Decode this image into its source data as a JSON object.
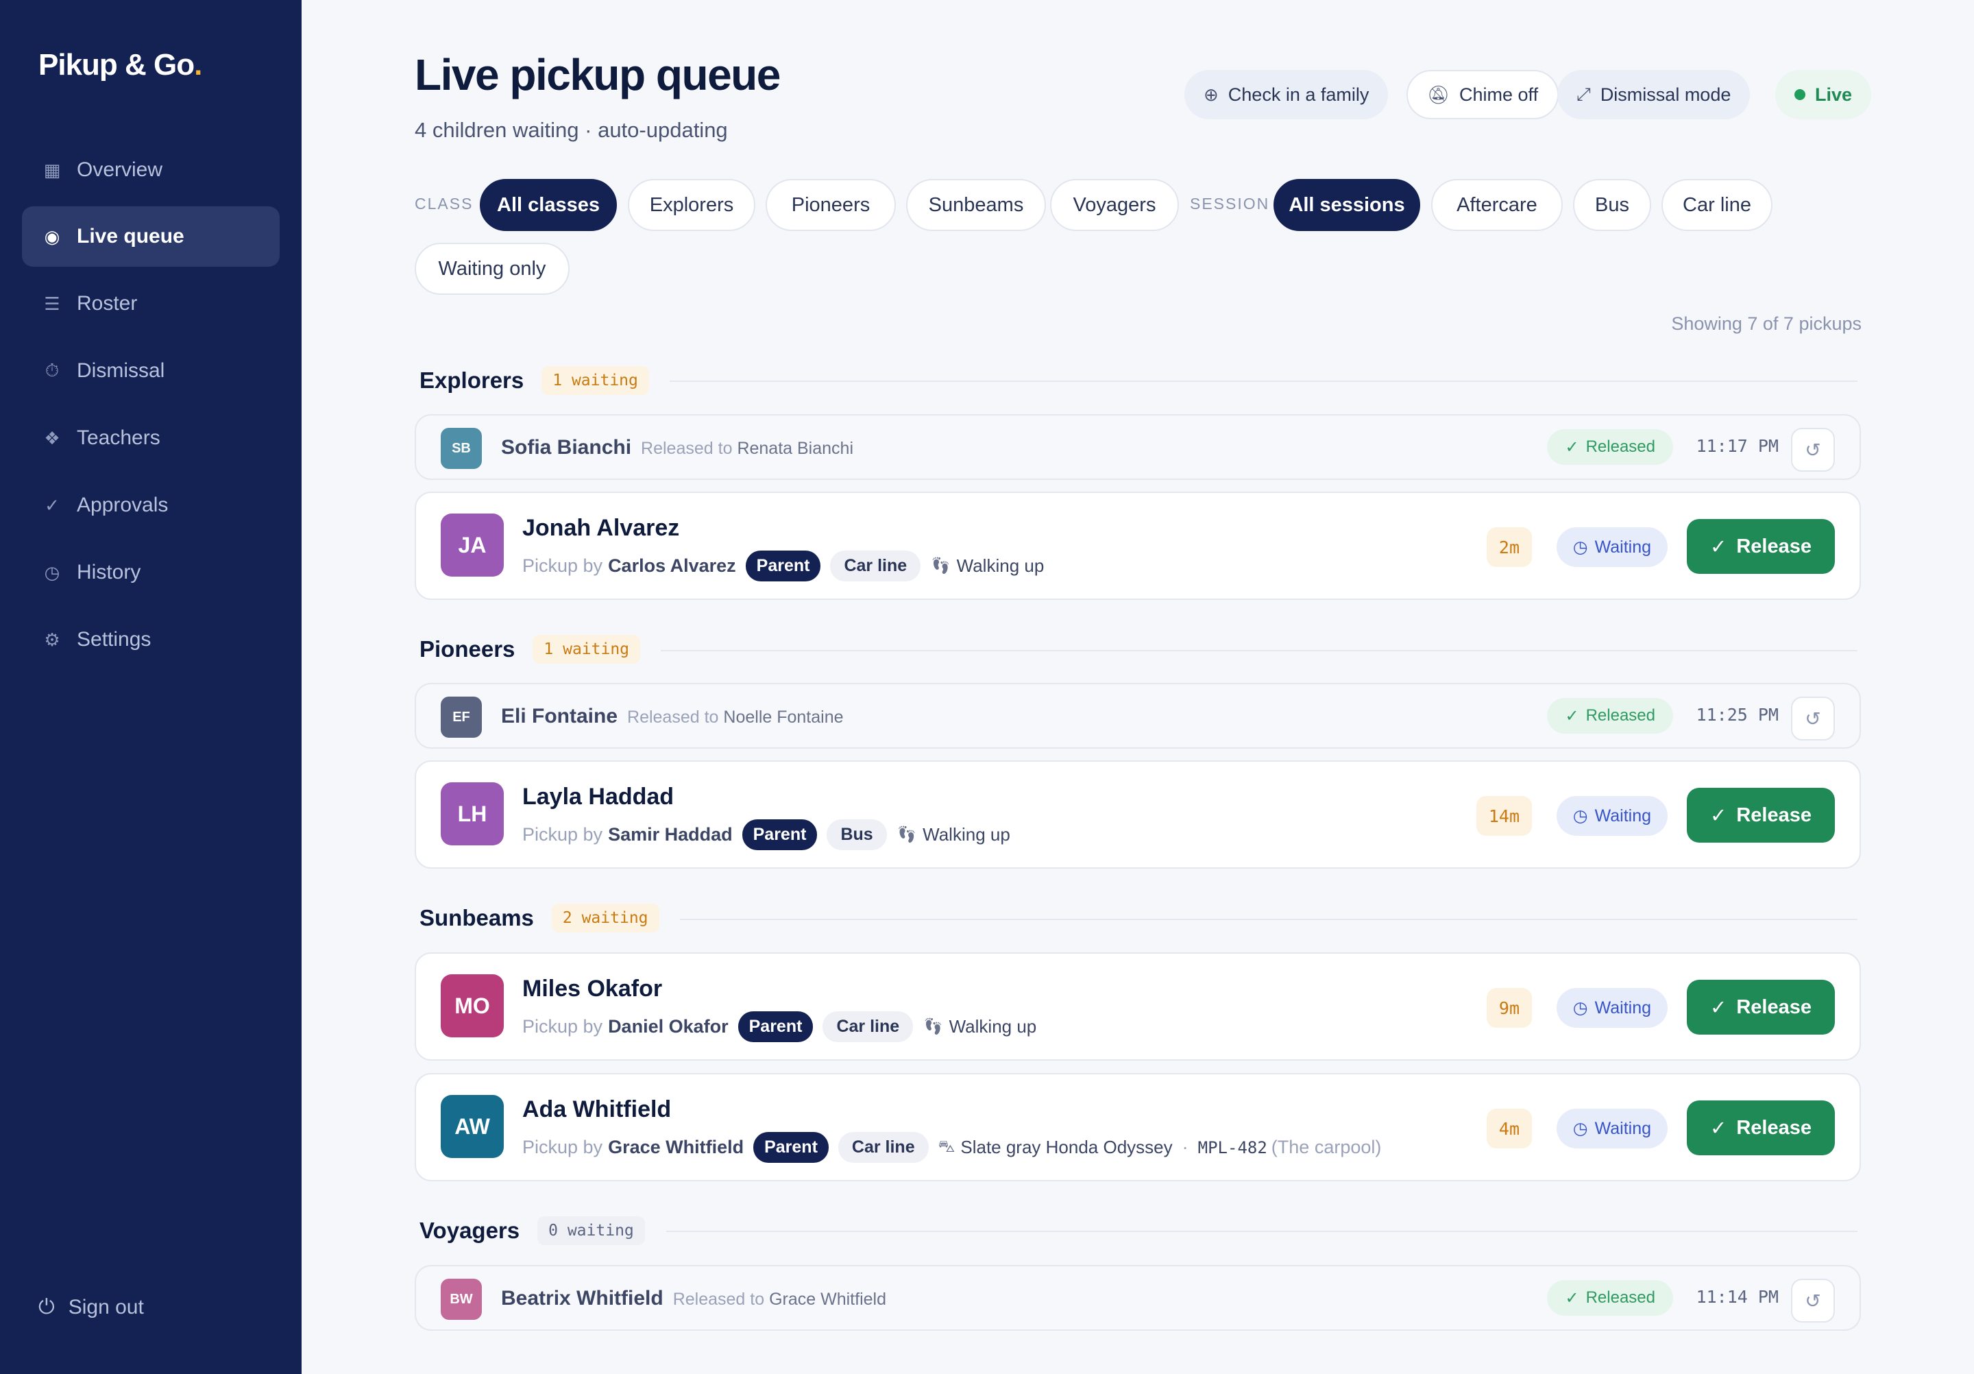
{
  "app": {
    "logo": "Pikup & Go",
    "logo_dot": "."
  },
  "nav": [
    {
      "icon": "▦",
      "label": "Overview"
    },
    {
      "icon": "◉",
      "label": "Live queue"
    },
    {
      "icon": "☰",
      "label": "Roster"
    },
    {
      "icon": "⏱",
      "label": "Dismissal"
    },
    {
      "icon": "❖",
      "label": "Teachers"
    },
    {
      "icon": "✓",
      "label": "Approvals"
    },
    {
      "icon": "◷",
      "label": "History"
    },
    {
      "icon": "⚙",
      "label": "Settings"
    }
  ],
  "sign_out": {
    "icon": "⏻",
    "label": "Sign out"
  },
  "header": {
    "title": "Live pickup queue",
    "subtitle": "4 children waiting · auto-updating",
    "check_in": "Check in a family",
    "chime": "Chime off",
    "dismissal": "Dismissal mode",
    "live": "Live"
  },
  "filters": {
    "class_label": "CLASS",
    "classes": [
      "All classes",
      "Explorers",
      "Pioneers",
      "Sunbeams",
      "Voyagers"
    ],
    "session_label": "SESSION",
    "sessions": [
      "All sessions",
      "Aftercare",
      "Bus",
      "Car line"
    ],
    "waiting_only": "Waiting only"
  },
  "showing": "Showing 7 of 7 pickups",
  "groups": {
    "explorers": {
      "name": "Explorers",
      "badge": "1 waiting"
    },
    "pioneers": {
      "name": "Pioneers",
      "badge": "1 waiting"
    },
    "sunbeams": {
      "name": "Sunbeams",
      "badge": "2 waiting"
    },
    "voyagers": {
      "name": "Voyagers",
      "badge": "0 waiting"
    }
  },
  "released": [
    {
      "initials": "SB",
      "name": "Sofia Bianchi",
      "released_to_label": "Released to",
      "released_to": "Renata Bianchi",
      "status": "Released",
      "time": "11:17 PM",
      "color": "#4f8fa8"
    },
    {
      "initials": "EF",
      "name": "Eli Fontaine",
      "released_to_label": "Released to",
      "released_to": "Noelle Fontaine",
      "status": "Released",
      "time": "11:25 PM",
      "color": "#5a6480"
    },
    {
      "initials": "BW",
      "name": "Beatrix Whitfield",
      "released_to_label": "Released to",
      "released_to": "Grace Whitfield",
      "status": "Released",
      "time": "11:14 PM",
      "color": "#c46a9b"
    }
  ],
  "waiting": [
    {
      "initials": "JA",
      "name": "Jonah Alvarez",
      "pickup_label": "Pickup by",
      "pickup_by": "Carlos Alvarez",
      "role": "Parent",
      "session": "Car line",
      "meta": "Walking up",
      "mins": "2m",
      "status": "Waiting",
      "action": "Release",
      "color": "#9b59b6"
    },
    {
      "initials": "LH",
      "name": "Layla Haddad",
      "pickup_label": "Pickup by",
      "pickup_by": "Samir Haddad",
      "role": "Parent",
      "session": "Bus",
      "meta": "Walking up",
      "mins": "14m",
      "status": "Waiting",
      "action": "Release",
      "color": "#9b59b6"
    },
    {
      "initials": "MO",
      "name": "Miles Okafor",
      "pickup_label": "Pickup by",
      "pickup_by": "Daniel Okafor",
      "role": "Parent",
      "session": "Car line",
      "meta": "Walking up",
      "mins": "9m",
      "status": "Waiting",
      "action": "Release",
      "color": "#b83b7a"
    },
    {
      "initials": "AW",
      "name": "Ada Whitfield",
      "pickup_label": "Pickup by",
      "pickup_by": "Grace Whitfield",
      "role": "Parent",
      "session": "Car line",
      "meta": "Slate gray Honda Odyssey",
      "sep": "·",
      "plate": "MPL-482",
      "note": "(The carpool)",
      "mins": "4m",
      "status": "Waiting",
      "action": "Release",
      "color": "#156c8c"
    }
  ]
}
